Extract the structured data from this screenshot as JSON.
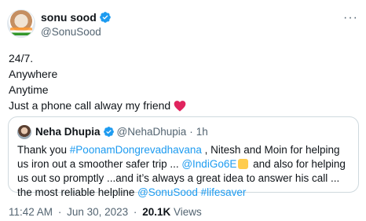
{
  "author": {
    "display_name": "sonu sood",
    "handle": "@SonuSood",
    "verified_icon": "verified-badge-icon"
  },
  "more_icon": "more-options-icon",
  "tweet": {
    "lines": [
      "24/7.",
      "Anywhere",
      "Anytime",
      "Just a phone call alway my friend"
    ],
    "heart_icon": "red-heart-emoji-icon"
  },
  "quoted_tweet": {
    "display_name": "Neha Dhupia",
    "handle": "@NehaDhupia",
    "dot": "·",
    "time": "1h",
    "text_parts": {
      "p1": "Thank you ",
      "hashtag1": "#PoonamDongrevadhavana",
      "p2": " , Nitesh and Moin for helping us iron out a smoother safer trip ... ",
      "mention1": "@IndiGo6E",
      "p3": " and also for helping us out so promptly ...and it’s always a great idea to answer his call ... the most reliable helpline ",
      "mention2": "@SonuSood",
      "p4": " ",
      "hashtag2": "#lifesaver"
    },
    "emoji_icon": "raising-hands-emoji-icon"
  },
  "meta": {
    "time": "11:42 AM",
    "sep1": "·",
    "date": "Jun 30, 2023",
    "sep2": "·",
    "views_count": "20.1K",
    "views_label": "Views"
  },
  "colors": {
    "link": "#1d9bf0",
    "verified": "#1d9bf0",
    "heart": "#e0245e",
    "secondary_text": "#536471"
  }
}
